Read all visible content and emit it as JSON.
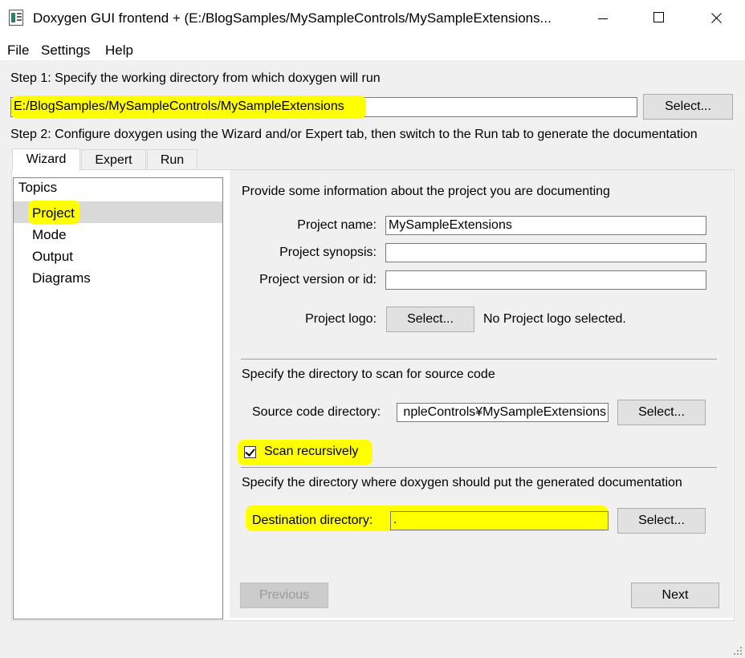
{
  "window": {
    "title": "Doxygen GUI frontend + (E:/BlogSamples/MySampleControls/MySampleExtensions..."
  },
  "menu": [
    "File",
    "Settings",
    "Help"
  ],
  "step1": {
    "label": "Step 1: Specify the working directory from which doxygen will run",
    "working_dir": "E:/BlogSamples/MySampleControls/MySampleExtensions",
    "select_label": "Select..."
  },
  "step2": {
    "label": "Step 2: Configure doxygen using the Wizard and/or Expert tab, then switch to the Run tab to generate the documentation"
  },
  "tabs": [
    "Wizard",
    "Expert",
    "Run"
  ],
  "topics": {
    "header": "Topics",
    "items": [
      "Project",
      "Mode",
      "Output",
      "Diagrams"
    ]
  },
  "project": {
    "intro": "Provide some information about the project you are documenting",
    "name_label": "Project name:",
    "name_value": "MySampleExtensions",
    "synopsis_label": "Project synopsis:",
    "synopsis_value": "",
    "version_label": "Project version or id:",
    "version_value": "",
    "logo_label": "Project logo:",
    "logo_button": "Select...",
    "logo_status": "No Project logo selected."
  },
  "source": {
    "intro": "Specify the directory to scan for source code",
    "dir_label": "Source code directory:",
    "dir_value": "npleControls¥MySampleExtensions",
    "select_label": "Select...",
    "scan_recursively_label": "Scan recursively"
  },
  "destination": {
    "intro": "Specify the directory where doxygen should put the generated documentation",
    "dir_label": "Destination directory:",
    "dir_value": ".",
    "select_label": "Select..."
  },
  "nav": {
    "previous": "Previous",
    "next": "Next"
  },
  "colors": {
    "highlight": "#ffff00",
    "selection": "#d9d9d9"
  }
}
